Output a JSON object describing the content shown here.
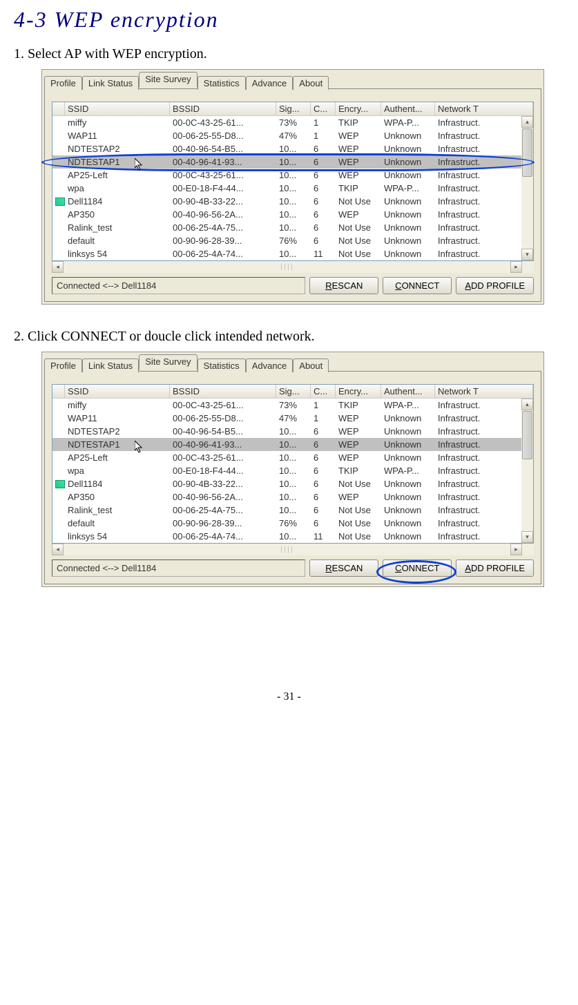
{
  "section_title": "4-3  WEP encryption",
  "step1": "1. Select AP with WEP encryption.",
  "step2": "2. Click CONNECT or doucle click intended network.",
  "page_num": "- 31 -",
  "tabs": {
    "t0": "Profile",
    "t1": "Link Status",
    "t2": "Site Survey",
    "t3": "Statistics",
    "t4": "Advance",
    "t5": "About"
  },
  "cols": {
    "ssid": "SSID",
    "bssid": "BSSID",
    "sig": "Sig...",
    "ch": "C...",
    "enc": "Encry...",
    "auth": "Authent...",
    "net": "Network T"
  },
  "status": "Connected <--> Dell1184",
  "btns": {
    "rescan_pre": "R",
    "rescan_post": "ESCAN",
    "connect_pre": "C",
    "connect_post": "ONNECT",
    "add_pre": "A",
    "add_post": "DD PROFILE"
  },
  "rows": [
    {
      "ssid": "miffy",
      "bssid": "00-0C-43-25-61...",
      "sig": "73%",
      "ch": "1",
      "enc": "TKIP",
      "auth": "WPA-P...",
      "net": "Infrastruct."
    },
    {
      "ssid": "WAP11",
      "bssid": "00-06-25-55-D8...",
      "sig": "47%",
      "ch": "1",
      "enc": "WEP",
      "auth": "Unknown",
      "net": "Infrastruct."
    },
    {
      "ssid": "NDTESTAP2",
      "bssid": "00-40-96-54-B5...",
      "sig": "10...",
      "ch": "6",
      "enc": "WEP",
      "auth": "Unknown",
      "net": "Infrastruct."
    },
    {
      "ssid": "NDTESTAP1",
      "bssid": "00-40-96-41-93...",
      "sig": "10...",
      "ch": "6",
      "enc": "WEP",
      "auth": "Unknown",
      "net": "Infrastruct.",
      "sel": true
    },
    {
      "ssid": "AP25-Left",
      "bssid": "00-0C-43-25-61...",
      "sig": "10...",
      "ch": "6",
      "enc": "WEP",
      "auth": "Unknown",
      "net": "Infrastruct."
    },
    {
      "ssid": "wpa",
      "bssid": "00-E0-18-F4-44...",
      "sig": "10...",
      "ch": "6",
      "enc": "TKIP",
      "auth": "WPA-P...",
      "net": "Infrastruct."
    },
    {
      "ssid": "Dell1184",
      "bssid": "00-90-4B-33-22...",
      "sig": "10...",
      "ch": "6",
      "enc": "Not Use",
      "auth": "Unknown",
      "net": "Infrastruct.",
      "icon": true
    },
    {
      "ssid": "AP350",
      "bssid": "00-40-96-56-2A...",
      "sig": "10...",
      "ch": "6",
      "enc": "WEP",
      "auth": "Unknown",
      "net": "Infrastruct."
    },
    {
      "ssid": "Ralink_test",
      "bssid": "00-06-25-4A-75...",
      "sig": "10...",
      "ch": "6",
      "enc": "Not Use",
      "auth": "Unknown",
      "net": "Infrastruct."
    },
    {
      "ssid": "default",
      "bssid": "00-90-96-28-39...",
      "sig": "76%",
      "ch": "6",
      "enc": "Not Use",
      "auth": "Unknown",
      "net": "Infrastruct."
    },
    {
      "ssid": "linksys 54",
      "bssid": "00-06-25-4A-74...",
      "sig": "10...",
      "ch": "11",
      "enc": "Not Use",
      "auth": "Unknown",
      "net": "Infrastruct."
    }
  ]
}
